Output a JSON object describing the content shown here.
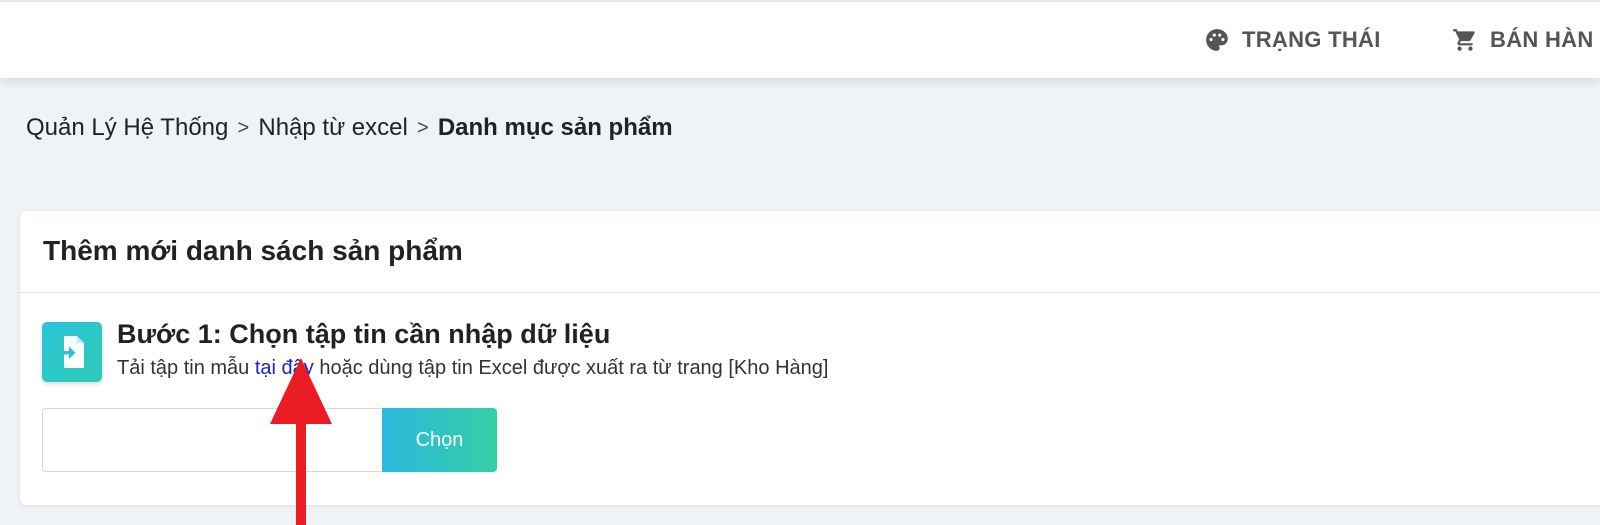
{
  "header": {
    "nav": [
      {
        "label": "TRẠNG THÁI",
        "icon": "palette-icon"
      },
      {
        "label": "BÁN HÀN",
        "icon": "cart-icon"
      }
    ]
  },
  "breadcrumb": {
    "items": [
      "Quản Lý Hệ Thống",
      "Nhập từ excel"
    ],
    "separator": ">",
    "current": "Danh mục sản phẩm"
  },
  "card": {
    "title": "Thêm mới danh sách sản phẩm",
    "step": {
      "icon": "file-import-icon",
      "title": "Bước 1: Chọn tập tin cần nhập dữ liệu",
      "desc_prefix": "Tải tập tin mẫu",
      "desc_link": "tại đây",
      "desc_suffix": "hoặc dùng tập tin Excel được xuất ra từ trang [Kho Hàng]"
    },
    "file_input": {
      "value": "",
      "placeholder": ""
    },
    "choose_button": "Chọn"
  },
  "colors": {
    "accent_gradient_start": "#2bb9e0",
    "accent_gradient_end": "#33cfa4",
    "link": "#1a22c9",
    "annotation_arrow": "#ec1c24",
    "page_background": "#eff2f7"
  }
}
